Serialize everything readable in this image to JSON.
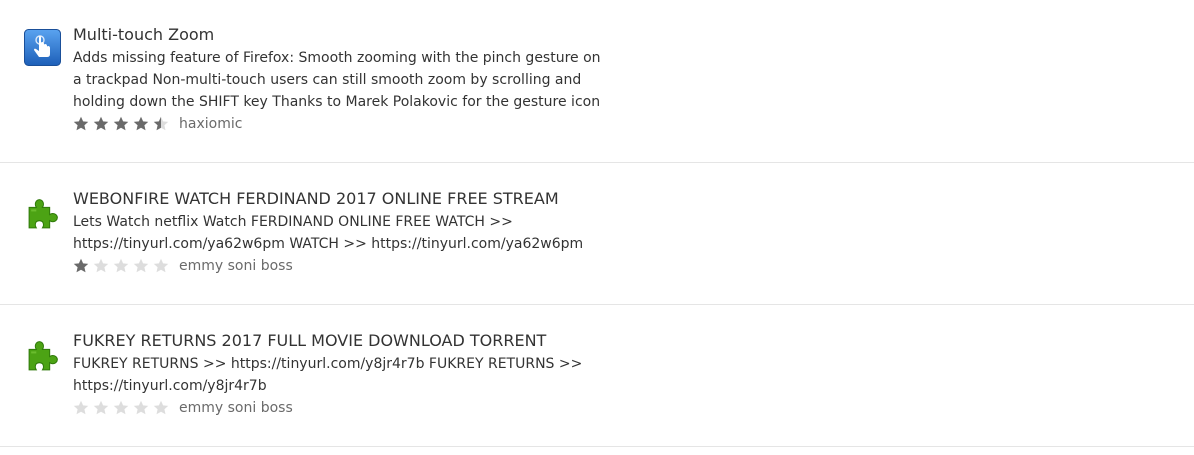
{
  "addons": [
    {
      "title": "Multi-touch Zoom",
      "summary": "Adds missing feature of Firefox: Smooth zooming with the pinch gesture on a trackpad Non-multi-touch users can still smooth zoom by scrolling and holding down the SHIFT key Thanks to Marek Polakovic for the gesture icon",
      "rating": 4.5,
      "author": "haxiomic",
      "icon": "hand-touch-icon"
    },
    {
      "title": "WEBONFIRE WATCH FERDINAND 2017 ONLINE FREE STREAM",
      "summary": "Lets Watch netflix Watch FERDINAND ONLINE FREE WATCH >> https://tinyurl.com/ya62w6pm WATCH >> https://tinyurl.com/ya62w6pm",
      "rating": 1,
      "author": "emmy soni boss",
      "icon": "puzzle-piece-icon"
    },
    {
      "title": "FUKREY RETURNS 2017 FULL MOVIE DOWNLOAD TORRENT",
      "summary": "FUKREY RETURNS >> https://tinyurl.com/y8jr4r7b FUKREY RETURNS >> https://tinyurl.com/y8jr4r7b",
      "rating": 0,
      "author": "emmy soni boss",
      "icon": "puzzle-piece-icon"
    }
  ],
  "colors": {
    "star_filled": "#6a6a6a",
    "star_empty": "#dddddd",
    "puzzle_green": "#4ca314",
    "touch_blue": "#2a6fc9"
  }
}
